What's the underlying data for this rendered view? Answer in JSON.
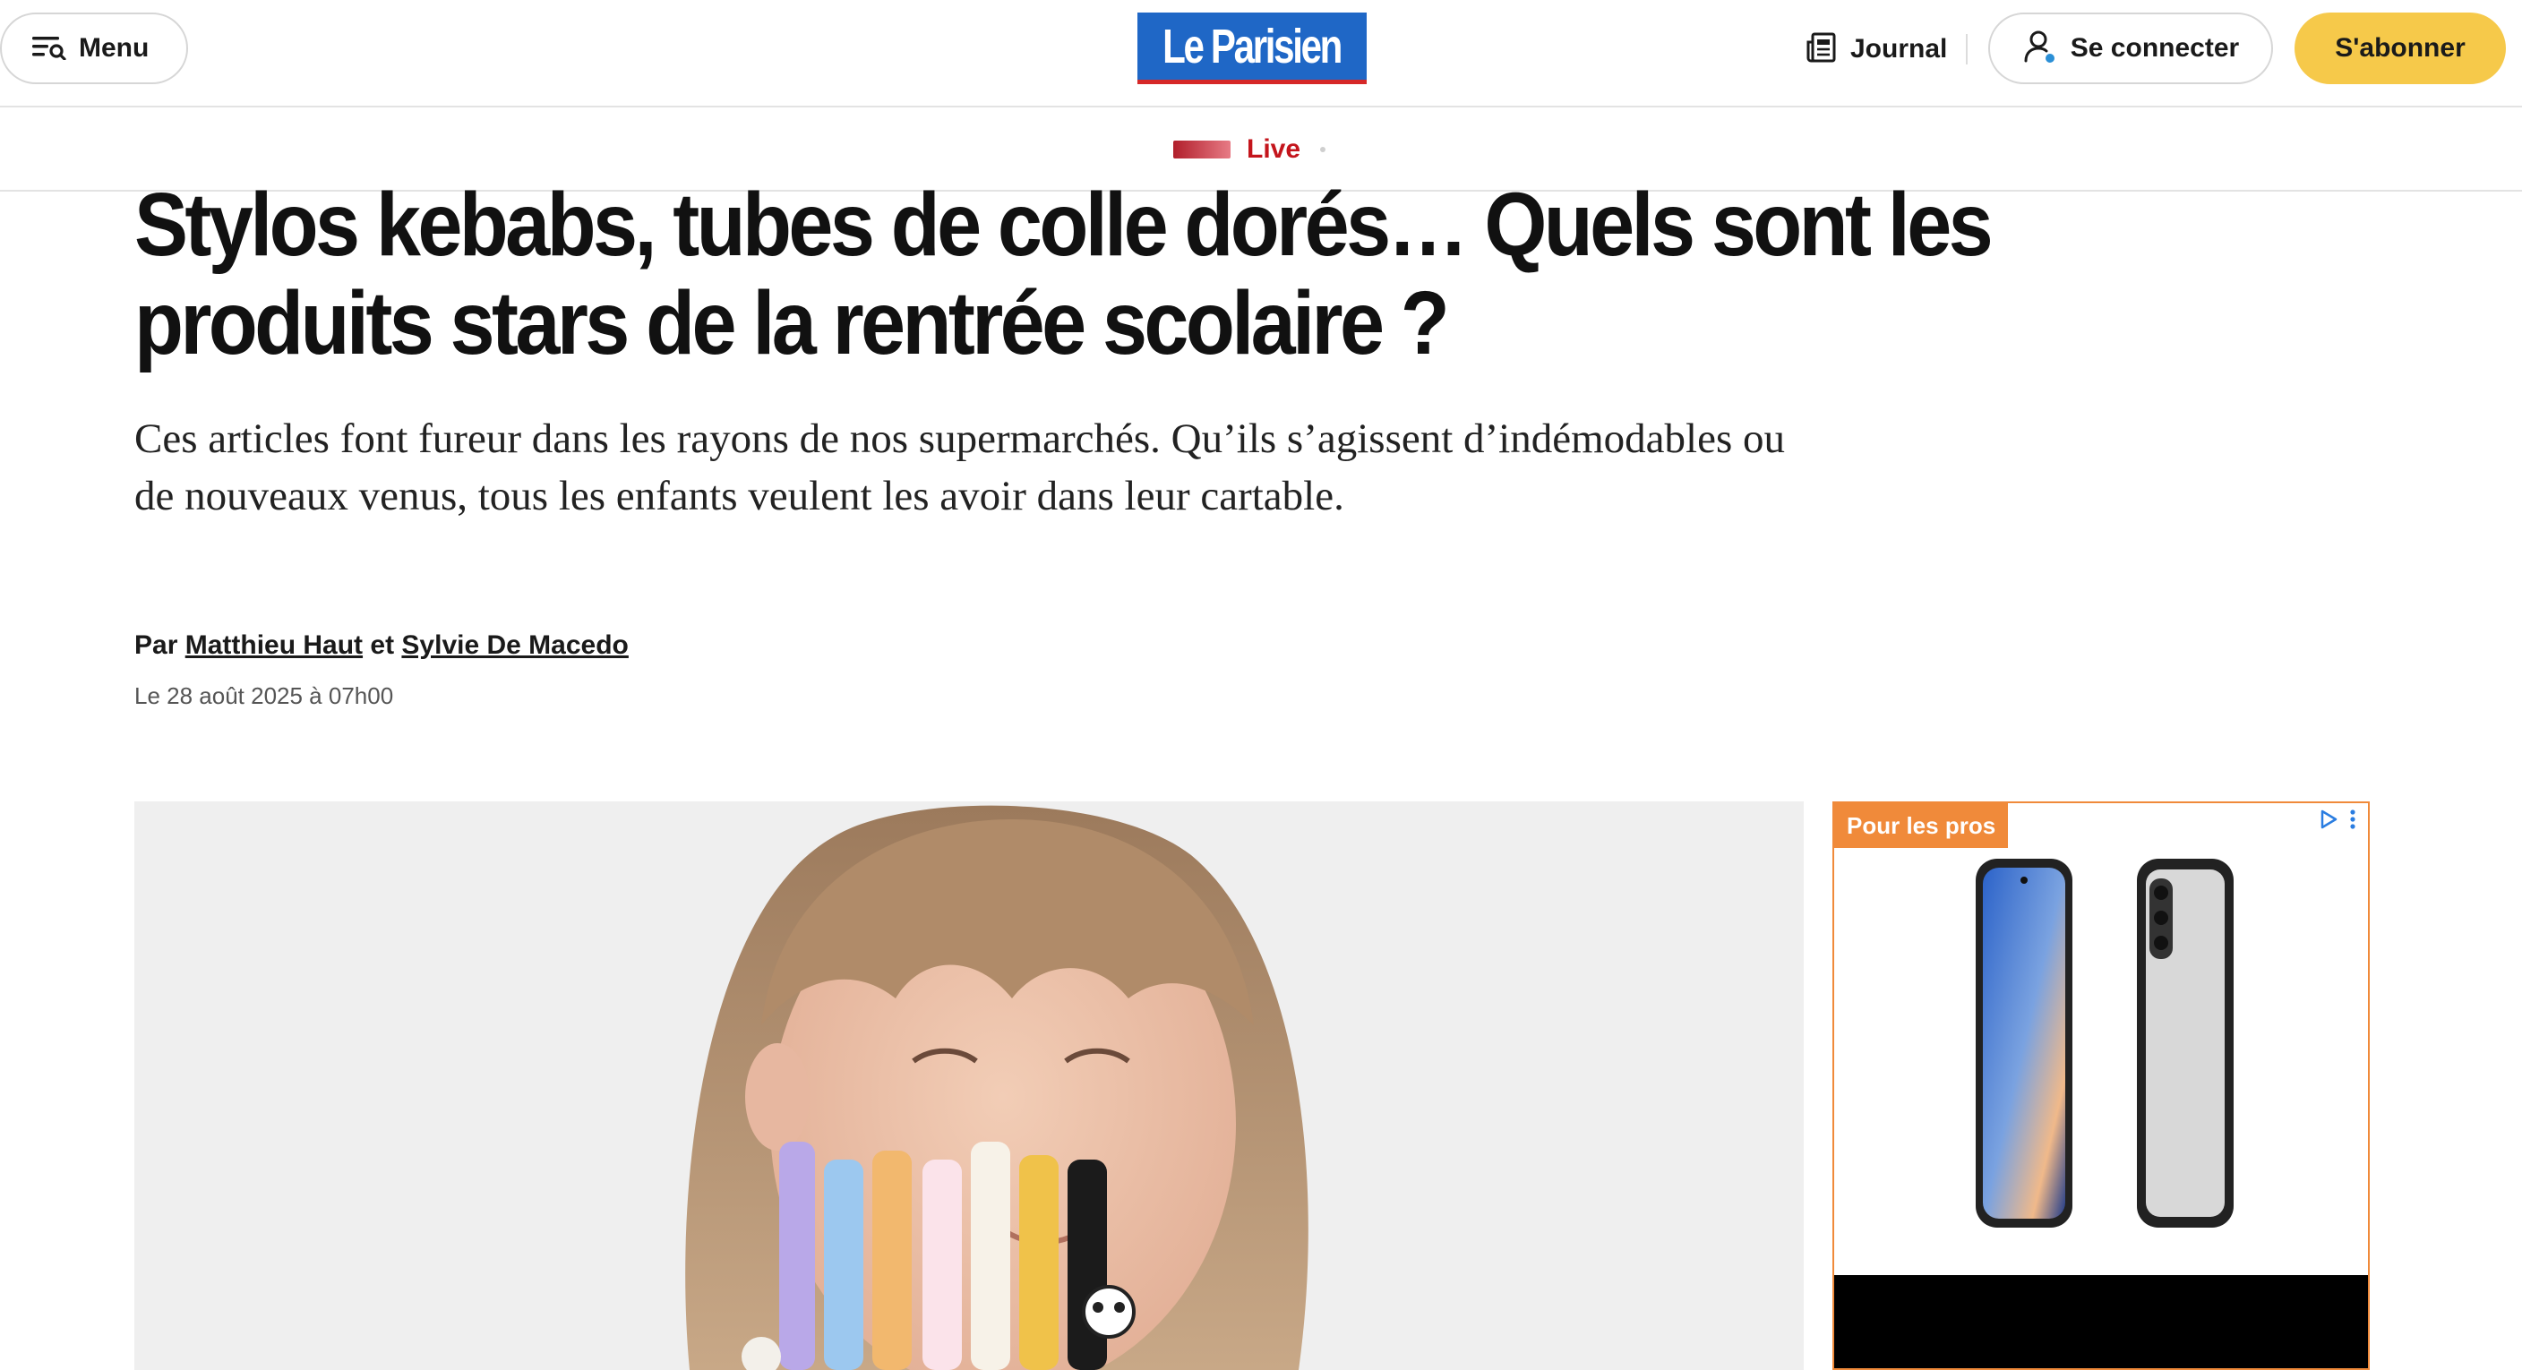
{
  "header": {
    "menu_label": "Menu",
    "logo_text": "Le Parisien",
    "journal_label": "Journal",
    "connect_label": "Se connecter",
    "subscribe_label": "S'abonner",
    "logo_color": "#1f67c6",
    "subscribe_color": "#f6c94a"
  },
  "live": {
    "label": "Live",
    "color": "#c4151c"
  },
  "article": {
    "headline": "Stylos kebabs, tubes de colle dorés… Quels sont les produits stars de la rentrée scolaire ?",
    "lede": "Ces articles font fureur dans les rayons de nos supermarchés. Qu’ils s’agissent d’indémodables ou de nouveaux venus, tous les enfants veulent les avoir dans leur cartable.",
    "byline": {
      "prefix": "Par",
      "author1": "Matthieu Haut",
      "conjunction": "et",
      "author2": "Sylvie De Macedo"
    },
    "date": "Le 28 août 2025 à 07h00"
  },
  "ad": {
    "tag": "Pour les pros",
    "accent": "#f08a3a",
    "icons": [
      "adchoices-icon",
      "more-vertical-icon"
    ]
  }
}
